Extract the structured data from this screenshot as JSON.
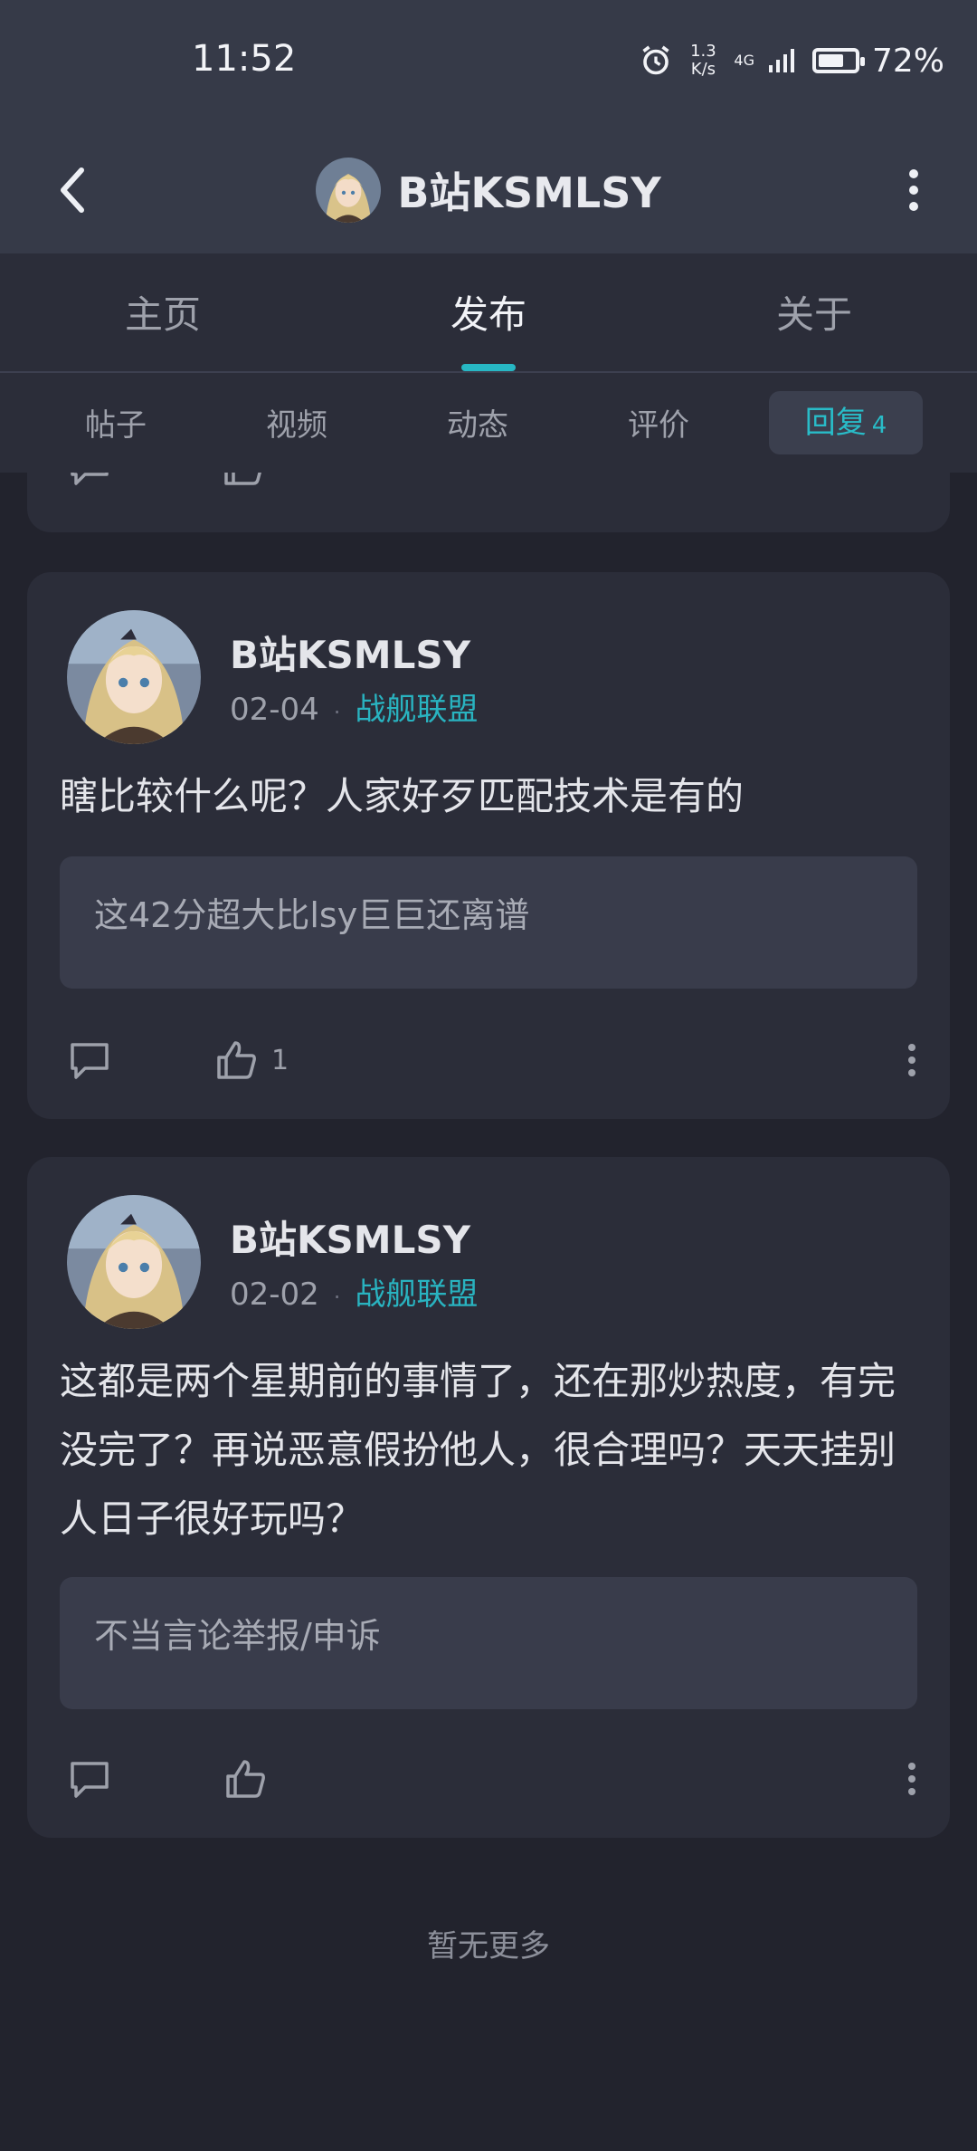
{
  "status": {
    "time": "11:52",
    "speed_top": "1.3",
    "speed_bottom": "K/s",
    "net": "4G",
    "battery": "72%",
    "battery_level": 0.72
  },
  "nav": {
    "title": "B站KSMLSY"
  },
  "tabs": [
    {
      "label": "主页"
    },
    {
      "label": "发布"
    },
    {
      "label": "关于"
    }
  ],
  "subtabs": [
    {
      "label": "帖子"
    },
    {
      "label": "视频"
    },
    {
      "label": "动态"
    },
    {
      "label": "评价"
    },
    {
      "label": "回复",
      "count": "4"
    }
  ],
  "posts": [
    {
      "author": "B站KSMLSY",
      "date": "02-04",
      "tag": "战舰联盟",
      "text": "瞎比较什么呢？人家好歹匹配技术是有的",
      "quote": "这42分超大比lsy巨巨还离谱",
      "likes": "1"
    },
    {
      "author": "B站KSMLSY",
      "date": "02-02",
      "tag": "战舰联盟",
      "text": "这都是两个星期前的事情了，还在那炒热度，有完没完了？再说恶意假扮他人，很合理吗？天天挂别人日子很好玩吗？",
      "quote": "不当言论举报/申诉",
      "likes": ""
    }
  ],
  "footer": {
    "end_text": "暂无更多"
  },
  "colors": {
    "accent": "#27b7c4",
    "background": "#22232d",
    "card": "#2b2d39"
  }
}
